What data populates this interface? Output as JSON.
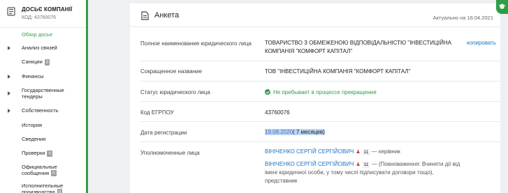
{
  "sidebar": {
    "title": "ДОСЬЄ КОМПАНІЇ",
    "code": "КОД: 43760076",
    "items": [
      {
        "label": "Обзор досье",
        "arrow": false,
        "badge": null
      },
      {
        "label": "Анализ связей",
        "arrow": true,
        "badge": null
      },
      {
        "label": "Санкции",
        "arrow": false,
        "badge": "0"
      },
      {
        "label": "Финансы",
        "arrow": true,
        "badge": null
      },
      {
        "label": "Государственные тендеры",
        "arrow": true,
        "badge": null
      },
      {
        "label": "Собственность",
        "arrow": true,
        "badge": null
      },
      {
        "label": "История",
        "arrow": false,
        "badge": null
      },
      {
        "label": "Сведения",
        "arrow": false,
        "badge": null
      },
      {
        "label": "Проверки",
        "arrow": false,
        "badge": "0"
      },
      {
        "label": "Официальные сообщения",
        "arrow": false,
        "badge": "0"
      },
      {
        "label": "Исполнительные производства",
        "arrow": false,
        "badge": "0"
      }
    ]
  },
  "header": {
    "title": "Анкета",
    "actual": "Актуально на 16.04.2021"
  },
  "rows": {
    "full_name_label": "Полное наименование юридического лица",
    "full_name_value": "ТОВАРИСТВО З ОБМЕЖЕНОЮ ВІДПОВІДАЛЬНІСТЮ \"ІНВЕСТИЦІЙНА КОМПАНІЯ \"КОМФОРТ КАПІТАЛ\"",
    "copy_label": "копировать",
    "short_name_label": "Сокращенное название",
    "short_name_value": "ТОВ \"ІНВЕСТИЦІЙНА КОМПАНІЯ \"КОМФОРТ КАПІТАЛ\"",
    "status_label": "Статус юридического лица",
    "status_value": "Не пребывает в процессе прекращения",
    "edrpou_label": "Код ЕГРПОУ",
    "edrpou_value": "43760076",
    "reg_label": "Дата регистрации",
    "reg_date": "19.08.2020",
    "reg_age": "( 7 месяцев)",
    "auth_label": "Уполномоченные лица",
    "persons": [
      {
        "name": "ВІНІЧЕНКО СЕРГІЙ СЕРГІЙОВИЧ",
        "count": "11",
        "role": "— керівник"
      },
      {
        "name": "ВІНІЧЕНКО СЕРГІЙ СЕРГІЙОВИЧ",
        "count": "11",
        "role": "— (Повноваження: Вчиняти дії від імені юридичної особи, у тому числі підписувати договори тощо), представник"
      }
    ]
  },
  "colors": {
    "accent": "#2e9e44",
    "link": "#1a73c7"
  }
}
